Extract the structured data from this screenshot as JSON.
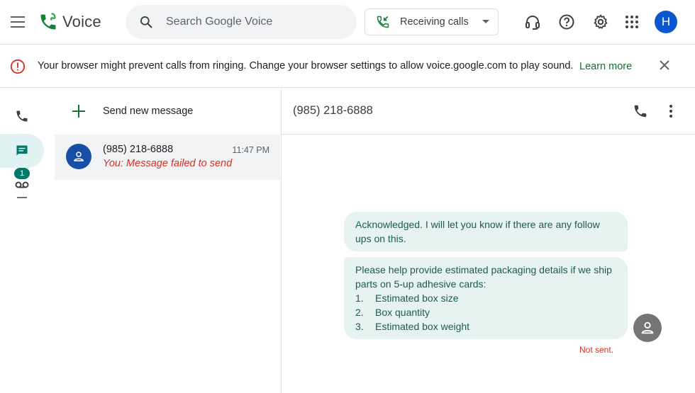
{
  "app": {
    "name": "Voice"
  },
  "header": {
    "search_placeholder": "Search Google Voice",
    "receiving_calls_label": "Receiving calls",
    "avatar_initial": "H"
  },
  "banner": {
    "text": "Your browser might prevent calls from ringing. Change your browser settings to allow voice.google.com to play sound.",
    "link_label": "Learn more"
  },
  "nav": {
    "voicemail_badge": "1"
  },
  "conversations": {
    "new_message_label": "Send new message",
    "items": [
      {
        "name": "(985) 218-6888",
        "time": "11:47 PM",
        "preview": "You: Message failed to send"
      }
    ]
  },
  "thread": {
    "title": "(985) 218-6888",
    "messages": [
      {
        "text": "Acknowledged. I will let you know if there are any follow ups on this."
      },
      {
        "intro": "Please help provide estimated packaging details if we ship parts on 5-up adhesive cards:",
        "list": [
          {
            "num": "1.",
            "text": "Estimated box size"
          },
          {
            "num": "2.",
            "text": "Box quantity"
          },
          {
            "num": "3.",
            "text": "Estimated box weight"
          }
        ]
      }
    ],
    "status": "Not sent."
  },
  "colors": {
    "accent": "#00796b",
    "error": "#d93025",
    "bubble_bg": "#e6f3f1",
    "link": "#137333"
  }
}
